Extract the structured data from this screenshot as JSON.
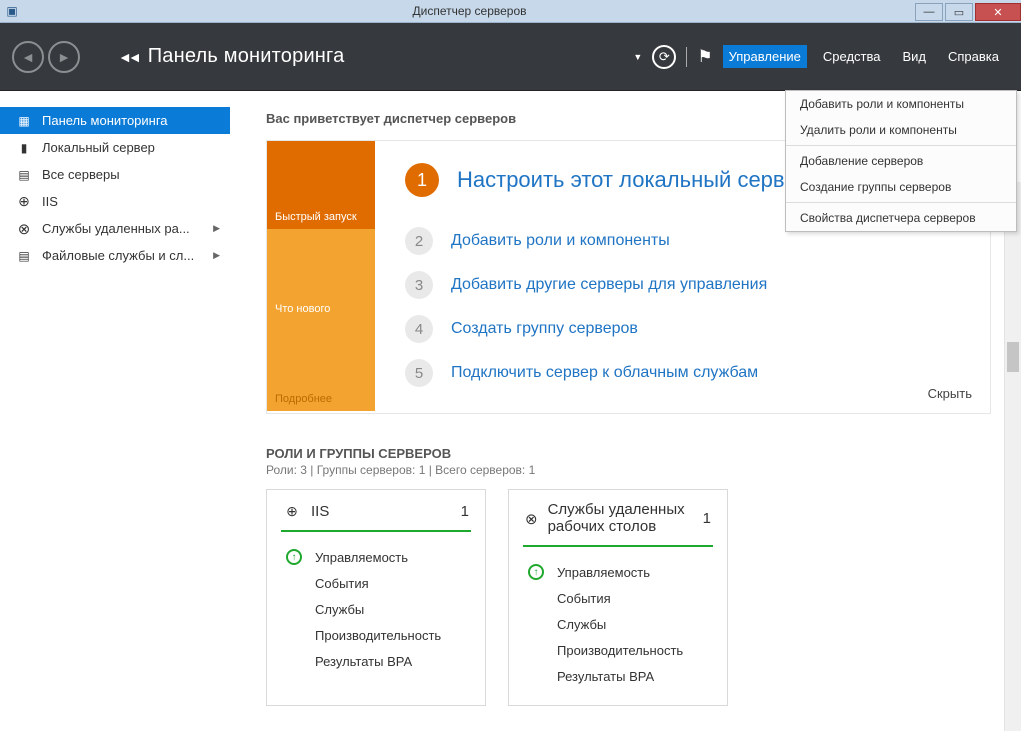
{
  "window": {
    "title": "Диспетчер серверов"
  },
  "header": {
    "breadcrumb": "Панель мониторинга",
    "menus": {
      "manage": "Управление",
      "tools": "Средства",
      "view": "Вид",
      "help": "Справка"
    }
  },
  "dropdown": {
    "items": [
      "Добавить роли и компоненты",
      "Удалить роли и компоненты",
      "Добавление серверов",
      "Создание группы серверов",
      "Свойства диспетчера серверов"
    ]
  },
  "sidebar": {
    "items": [
      {
        "label": "Панель мониторинга",
        "icon": "ico-grid"
      },
      {
        "label": "Локальный сервер",
        "icon": "ico-server"
      },
      {
        "label": "Все серверы",
        "icon": "ico-servers"
      },
      {
        "label": "IIS",
        "icon": "ico-globe"
      },
      {
        "label": "Службы удаленных ра...",
        "icon": "ico-rds",
        "arrow": true
      },
      {
        "label": "Файловые службы и сл...",
        "icon": "ico-disk",
        "arrow": true
      }
    ]
  },
  "welcome": {
    "title": "Вас приветствует диспетчер серверов",
    "left": {
      "quick": "Быстрый запуск",
      "new": "Что нового",
      "more": "Подробнее"
    },
    "steps": [
      {
        "n": "1",
        "label": "Настроить этот локальный серв"
      },
      {
        "n": "2",
        "label": "Добавить роли и компоненты"
      },
      {
        "n": "3",
        "label": "Добавить другие серверы для управления"
      },
      {
        "n": "4",
        "label": "Создать группу серверов"
      },
      {
        "n": "5",
        "label": "Подключить сервер к облачным службам"
      }
    ],
    "hide": "Скрыть"
  },
  "roles": {
    "header": "РОЛИ И ГРУППЫ СЕРВЕРОВ",
    "sub": "Роли: 3 | Группы серверов: 1 | Всего серверов: 1",
    "tiles": [
      {
        "title": "IIS",
        "count": "1",
        "icon": "ico-globe",
        "rows": [
          "Управляемость",
          "События",
          "Службы",
          "Производительность",
          "Результаты BPA"
        ]
      },
      {
        "title": "Службы удаленных рабочих столов",
        "count": "1",
        "icon": "ico-rds",
        "rows": [
          "Управляемость",
          "События",
          "Службы",
          "Производительность",
          "Результаты BPA"
        ]
      }
    ]
  }
}
